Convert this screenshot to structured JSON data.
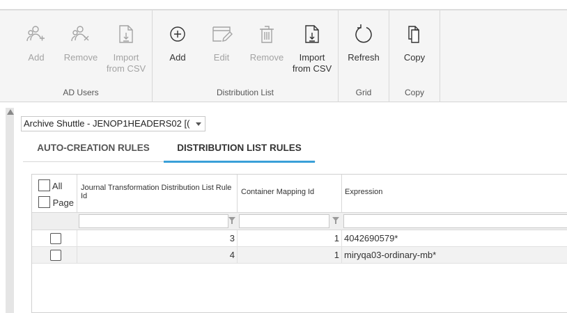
{
  "ribbon": {
    "ad_users": {
      "group_label": "AD Users",
      "buttons": [
        {
          "label": "Add",
          "icon": "add-user-icon"
        },
        {
          "label": "Remove",
          "icon": "remove-user-icon"
        },
        {
          "label": "Import\nfrom CSV",
          "icon": "import-csv-icon"
        }
      ]
    },
    "distribution_list": {
      "group_label": "Distribution List",
      "buttons": [
        {
          "label": "Add",
          "icon": "plus-circle-icon"
        },
        {
          "label": "Edit",
          "icon": "edit-icon"
        },
        {
          "label": "Remove",
          "icon": "trash-icon"
        },
        {
          "label": "Import\nfrom CSV",
          "icon": "import-csv-icon"
        }
      ]
    },
    "grid": {
      "group_label": "Grid",
      "buttons": [
        {
          "label": "Refresh",
          "icon": "refresh-icon"
        }
      ]
    },
    "copy": {
      "group_label": "Copy",
      "buttons": [
        {
          "label": "Copy",
          "icon": "copy-icon"
        }
      ]
    }
  },
  "selector": {
    "value": "Archive Shuttle - JENOP1HEADERS02 [("
  },
  "tabs": {
    "auto": "AUTO-CREATION RULES",
    "dist": "DISTRIBUTION LIST RULES",
    "active": "dist"
  },
  "grid": {
    "select_all": "All",
    "select_page": "Page",
    "columns": [
      "Journal Transformation Distribution List Rule Id",
      "Container Mapping Id",
      "Expression"
    ],
    "rows": [
      {
        "rule_id": "3",
        "container_mapping_id": "1",
        "expression": "4042690579*"
      },
      {
        "rule_id": "4",
        "container_mapping_id": "1",
        "expression": "miryqa03-ordinary-mb*"
      }
    ]
  },
  "colors": {
    "accent": "#3aa0d8",
    "ribbon_bg": "#f5f5f5",
    "disabled_text": "#a3a3a3"
  }
}
